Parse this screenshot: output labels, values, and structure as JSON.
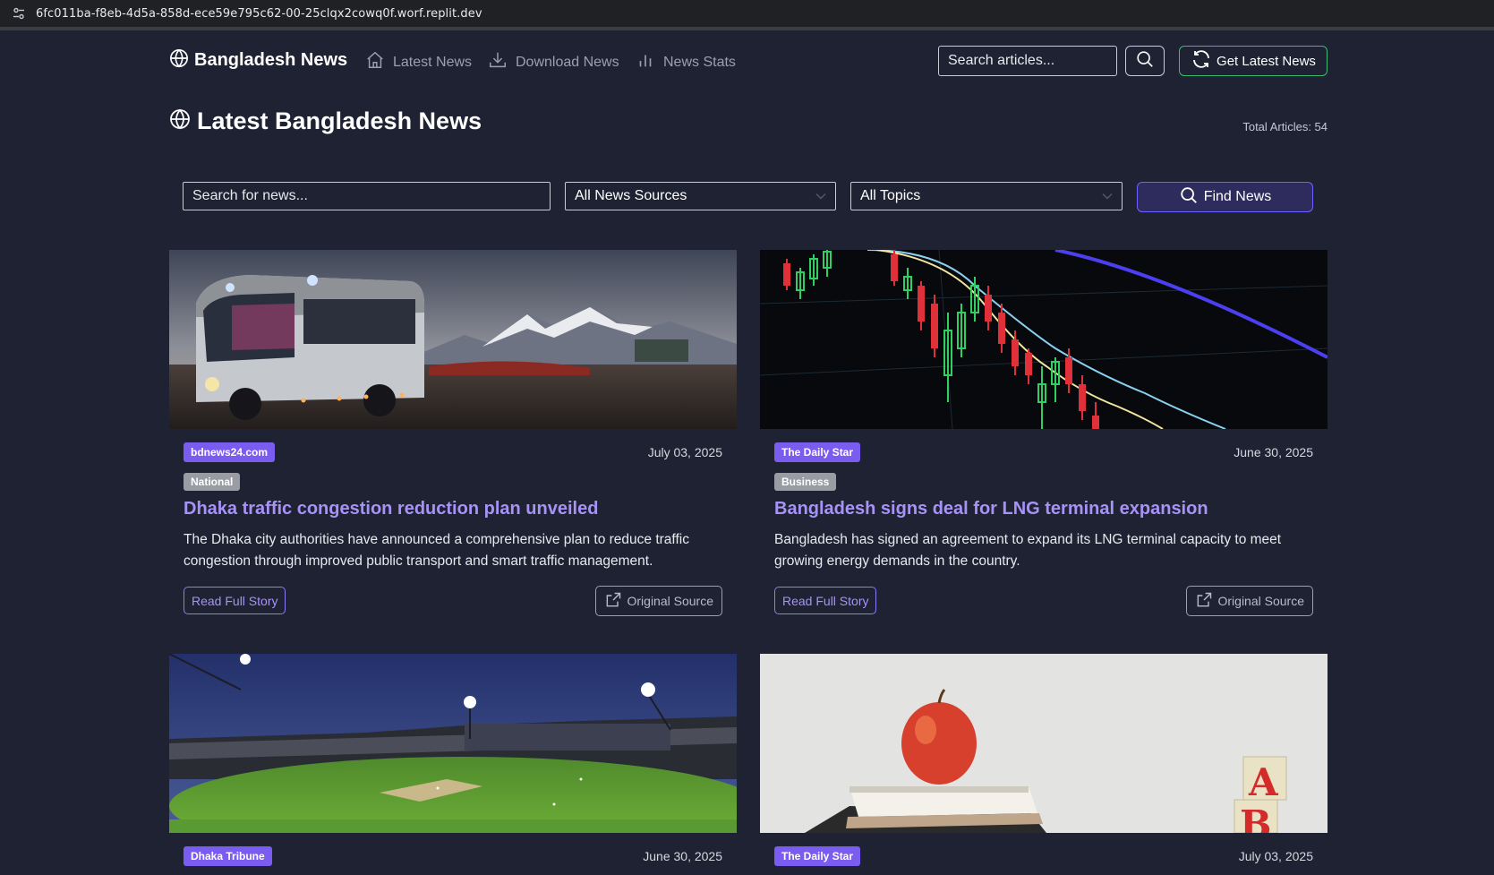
{
  "browser": {
    "url": "6fc011ba-f8eb-4d5a-858d-ece59e795c62-00-25clqx2cowq0f.worf.replit.dev"
  },
  "nav": {
    "brand": "Bangladesh News",
    "links": [
      {
        "label": "Latest News",
        "icon": "home-icon"
      },
      {
        "label": "Download News",
        "icon": "download-icon"
      },
      {
        "label": "News Stats",
        "icon": "bar-chart-icon"
      }
    ],
    "search_placeholder": "Search articles...",
    "get_latest_label": "Get Latest News"
  },
  "page": {
    "title": "Latest Bangladesh News",
    "total_articles": "Total Articles: 54"
  },
  "filters": {
    "search_placeholder": "Search for news...",
    "source_selected": "All News Sources",
    "topic_selected": "All Topics",
    "find_label": "Find News"
  },
  "articles": [
    {
      "source": "bdnews24.com",
      "date": "July 03, 2025",
      "topic": "National",
      "title": "Dhaka traffic congestion reduction plan unveiled",
      "summary": "The Dhaka city authorities have announced a comprehensive plan to reduce traffic congestion through improved public transport and smart traffic management.",
      "read_label": "Read Full Story",
      "source_label": "Original Source"
    },
    {
      "source": "The Daily Star",
      "date": "June 30, 2025",
      "topic": "Business",
      "title": "Bangladesh signs deal for LNG terminal expansion",
      "summary": "Bangladesh has signed an agreement to expand its LNG terminal capacity to meet growing energy demands in the country.",
      "read_label": "Read Full Story",
      "source_label": "Original Source"
    },
    {
      "source": "Dhaka Tribune",
      "date": "June 30, 2025"
    },
    {
      "source": "The Daily Star",
      "date": "July 03, 2025"
    }
  ],
  "colors": {
    "background": "#1e2232",
    "accent": "#7b5cf0",
    "headline": "#a793f7",
    "success": "#3fb871"
  }
}
